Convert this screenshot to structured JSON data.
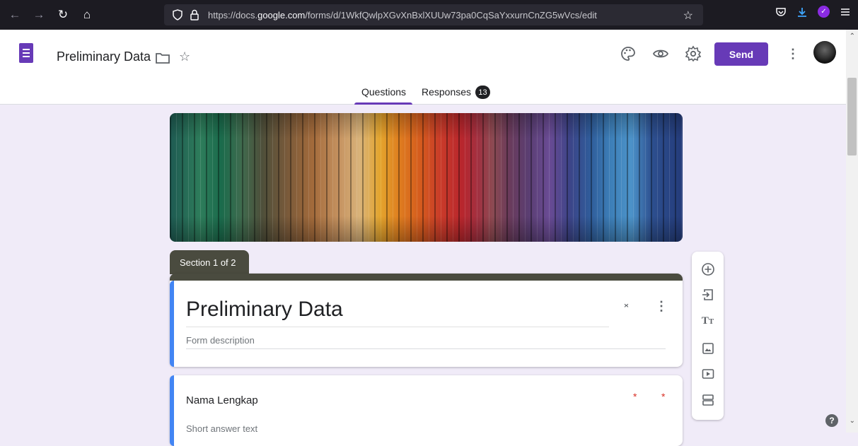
{
  "browser": {
    "url_prefix": "https://docs.",
    "url_domain": "google.com",
    "url_path": "/forms/d/1WkfQwlpXGvXnBxlXUUw73pa0CqSaYxxurnCnZG5wVcs/edit",
    "icons": [
      "back-icon",
      "forward-icon",
      "reload-icon",
      "home-icon",
      "shield-icon",
      "lock-icon",
      "bookmark-star-icon",
      "pocket-icon",
      "download-icon",
      "extension-icon",
      "menu-icon"
    ]
  },
  "header": {
    "doc_title": "Preliminary Data",
    "send_label": "Send",
    "icons": [
      "forms-logo-icon",
      "folder-icon",
      "star-icon",
      "palette-icon",
      "preview-eye-icon",
      "settings-gear-icon",
      "more-vert-icon",
      "avatar"
    ]
  },
  "tabs": [
    {
      "label": "Questions",
      "active": true
    },
    {
      "label": "Responses",
      "badge": "13"
    }
  ],
  "section": {
    "label": "Section 1 of 2"
  },
  "form": {
    "title": "Preliminary Data",
    "description_placeholder": "Form description"
  },
  "question": {
    "title": "Nama Lengkap",
    "required_mark": "*",
    "answer_placeholder": "Short answer text"
  },
  "toolbar": {
    "tools": [
      "add-question-icon",
      "import-questions-icon",
      "add-title-icon",
      "add-image-icon",
      "add-video-icon",
      "add-section-icon"
    ]
  },
  "help": {
    "label": "?"
  },
  "colors": {
    "accent": "#673ab7",
    "section": "#4a4b3f",
    "focus": "#4285f4",
    "required": "#d93025"
  }
}
